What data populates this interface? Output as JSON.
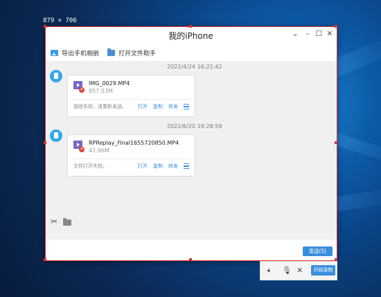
{
  "screen_badge": "879 × 706",
  "window": {
    "title": "我的iPhone",
    "controls": [
      "chevron-down",
      "minimize",
      "maximize",
      "close"
    ]
  },
  "toolbar": {
    "export_label": "导出手机相册",
    "open_helper_label": "打开文件助手"
  },
  "messages": [
    {
      "timestamp": "2022/4/24 16:21:42",
      "file_name": "IMG_0029.MP4",
      "file_size": "857.53M",
      "status": "接收失败，请重新发送。",
      "actions": [
        "打开",
        "复制",
        "转发"
      ]
    },
    {
      "timestamp": "2022/6/20 18:28:59",
      "file_name": "RPReplay_Final1655720850.MP4",
      "file_size": "42.96M",
      "status": "文件打开失败。",
      "actions": [
        "打开",
        "复制",
        "转发"
      ]
    }
  ],
  "composer": {
    "send_label": "发送(S)"
  },
  "recording_bar": {
    "start_label": "开始录制"
  },
  "colors": {
    "accent": "#3a8fdc",
    "avatar": "#33a8e8",
    "error": "#e04030",
    "selection": "#e03030"
  }
}
